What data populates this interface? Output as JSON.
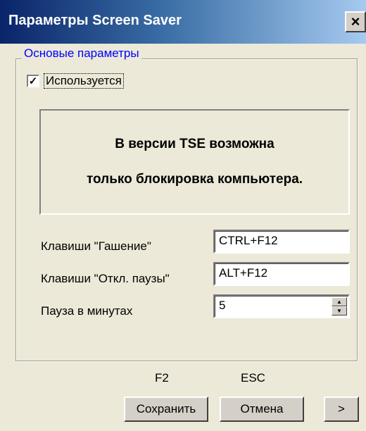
{
  "window": {
    "title": "Параметры Screen Saver",
    "close_label": "×"
  },
  "group": {
    "legend": "Основые параметры",
    "enabled_checkbox": {
      "label": "Используется",
      "checked": true,
      "mark": "✓"
    }
  },
  "info": {
    "line1": "В версии TSE возможна",
    "line2": "только блокировка компьютера."
  },
  "fields": {
    "blank_keys": {
      "label": "Клавиши \"Гашение\"",
      "value": "CTRL+F12"
    },
    "unpause_keys": {
      "label": "Клавиши \"Откл. паузы\"",
      "value": "ALT+F12"
    },
    "pause_minutes": {
      "label": "Пауза в минутах",
      "value": "5"
    }
  },
  "footer": {
    "save_hotkey": "F2",
    "cancel_hotkey": "ESC",
    "save_label": "Сохранить",
    "cancel_label": "Отмена",
    "next_label": ">"
  },
  "icons": {
    "spin_up": "▲",
    "spin_down": "▼"
  },
  "colors": {
    "title_start": "#0a246a",
    "title_end": "#a6caf0",
    "legend_text": "#0000ff",
    "dialog_bg": "#ece9d8"
  }
}
